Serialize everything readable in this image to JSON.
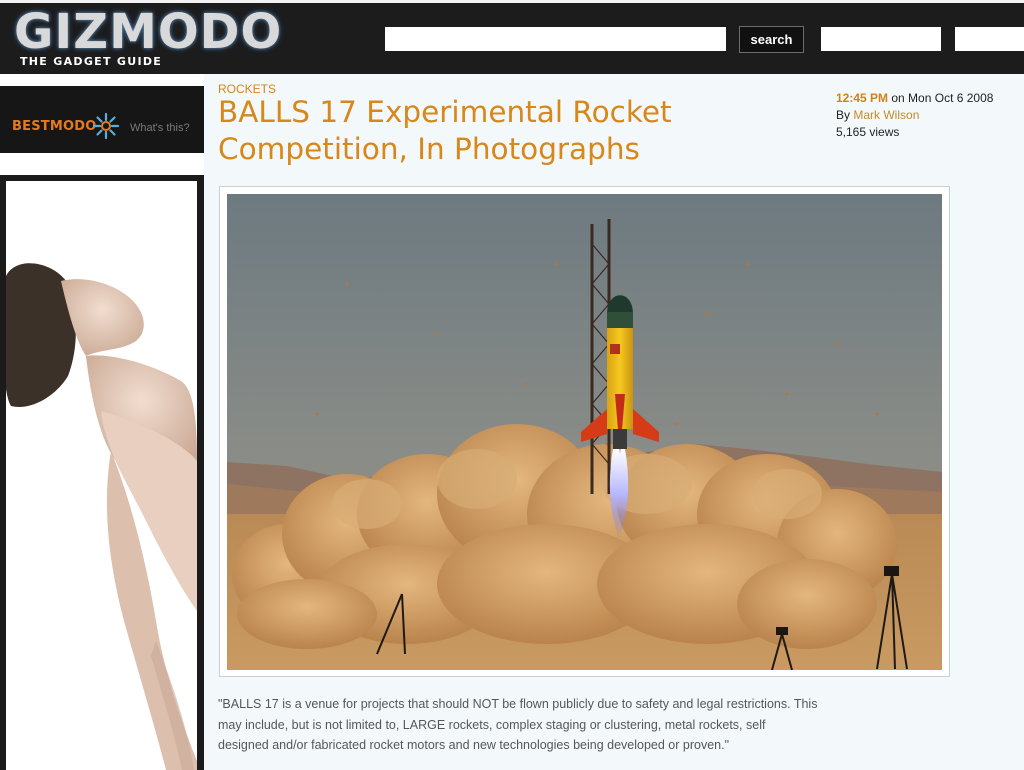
{
  "header": {
    "logo_text": "GIZMODO",
    "tagline": "THE GADGET GUIDE",
    "search_button_label": "search"
  },
  "sidebar": {
    "bestmodo_label": "BESTMODO",
    "whats_this": "What's this?"
  },
  "article": {
    "category": "ROCKETS",
    "title": "BALLS 17 Experimental Rocket Competition, In Photographs",
    "time": "12:45 PM",
    "date_text": "on Mon Oct 6 2008",
    "by_label": "By",
    "author": "Mark Wilson",
    "views": "5,165 views",
    "caption": "\"BALLS 17 is a venue for projects that should NOT be flown publicly due to safety and legal restrictions. This may include, but is not limited to, LARGE rockets, complex staging or clustering, metal rockets, self designed and/or fabricated rocket motors and new technologies being developed or proven.\""
  },
  "colors": {
    "accent_orange": "#d8871a",
    "header_bg": "#1c1c1c",
    "article_bg": "#f3f9fa"
  },
  "icons": [
    "bestmodo-star-icon"
  ]
}
